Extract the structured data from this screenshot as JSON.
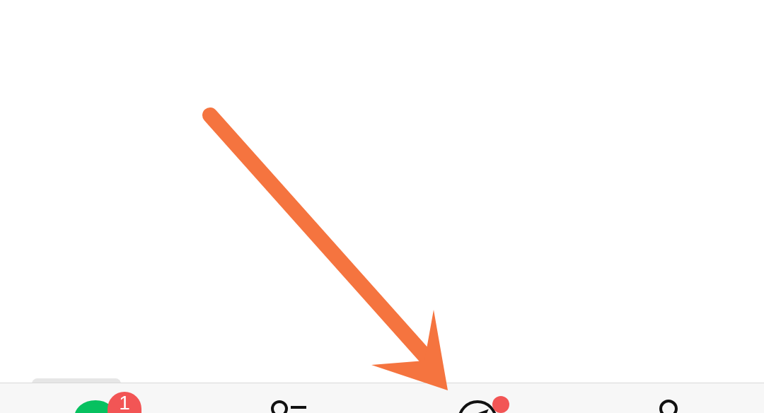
{
  "tab_bar": {
    "tabs": [
      {
        "kind": "chats",
        "selected": true,
        "badge": "1",
        "dot": false
      },
      {
        "kind": "contacts",
        "selected": false,
        "dot": false
      },
      {
        "kind": "discover",
        "selected": false,
        "dot": true
      },
      {
        "kind": "me",
        "selected": false,
        "dot": false
      }
    ]
  },
  "annotation": {
    "kind": "arrow",
    "color": "#f5743f"
  }
}
